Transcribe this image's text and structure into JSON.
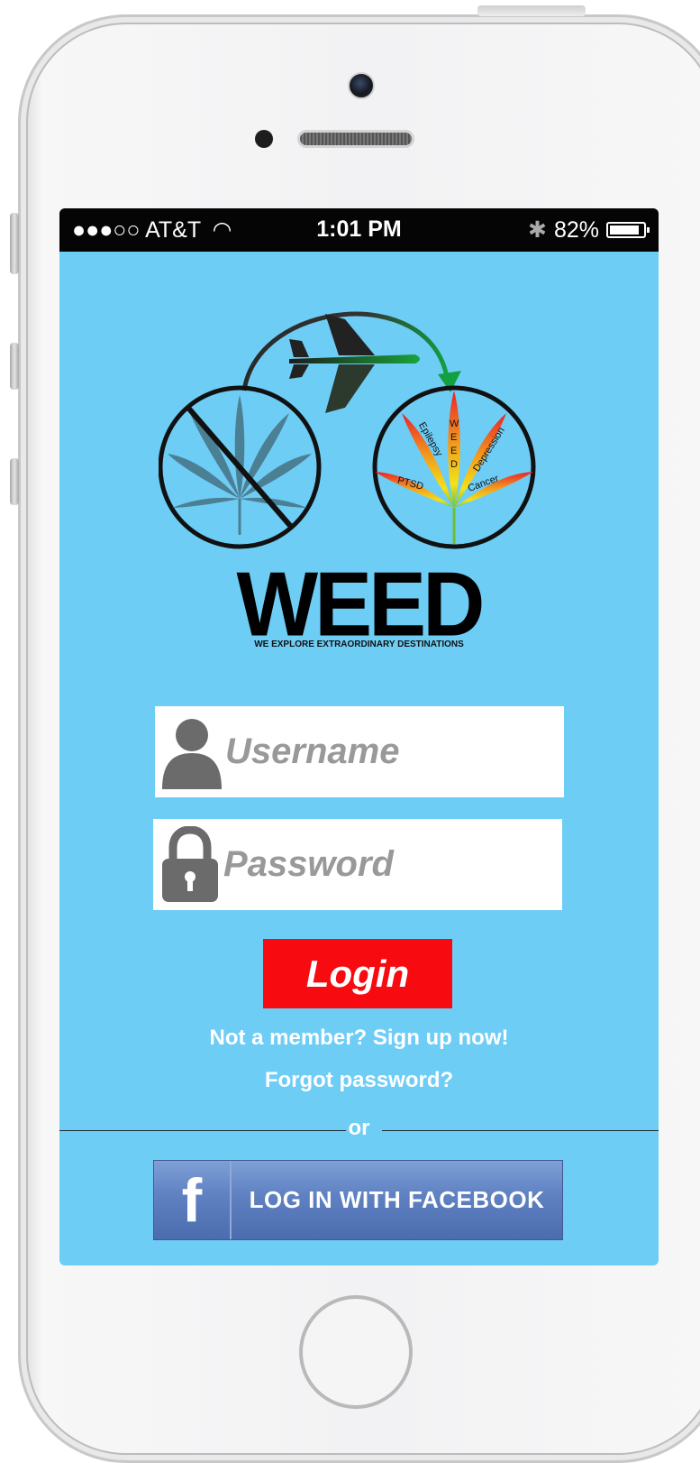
{
  "status_bar": {
    "carrier": "●●●○○ AT&T",
    "time": "1:01 PM",
    "battery": "82%"
  },
  "logo": {
    "wordmark": "WEED",
    "tagline": "WE EXPLORE EXTRAORDINARY DESTINATIONS",
    "leaf_words": [
      "W",
      "E",
      "E",
      "D",
      "Epilepsy",
      "Depression",
      "PTSD",
      "Cancer"
    ]
  },
  "login_form": {
    "username_placeholder": "Username",
    "password_placeholder": "Password",
    "login_label": "Login"
  },
  "links": {
    "signup": "Not a member? Sign up now!",
    "forgot": "Forgot password?",
    "or": "or"
  },
  "facebook": {
    "icon_letter": "f",
    "label": "LOG IN WITH FACEBOOK"
  },
  "colors": {
    "screen_bg": "#6ecdf5",
    "login_red": "#f70b10",
    "facebook_blue": "#5f80c1"
  }
}
